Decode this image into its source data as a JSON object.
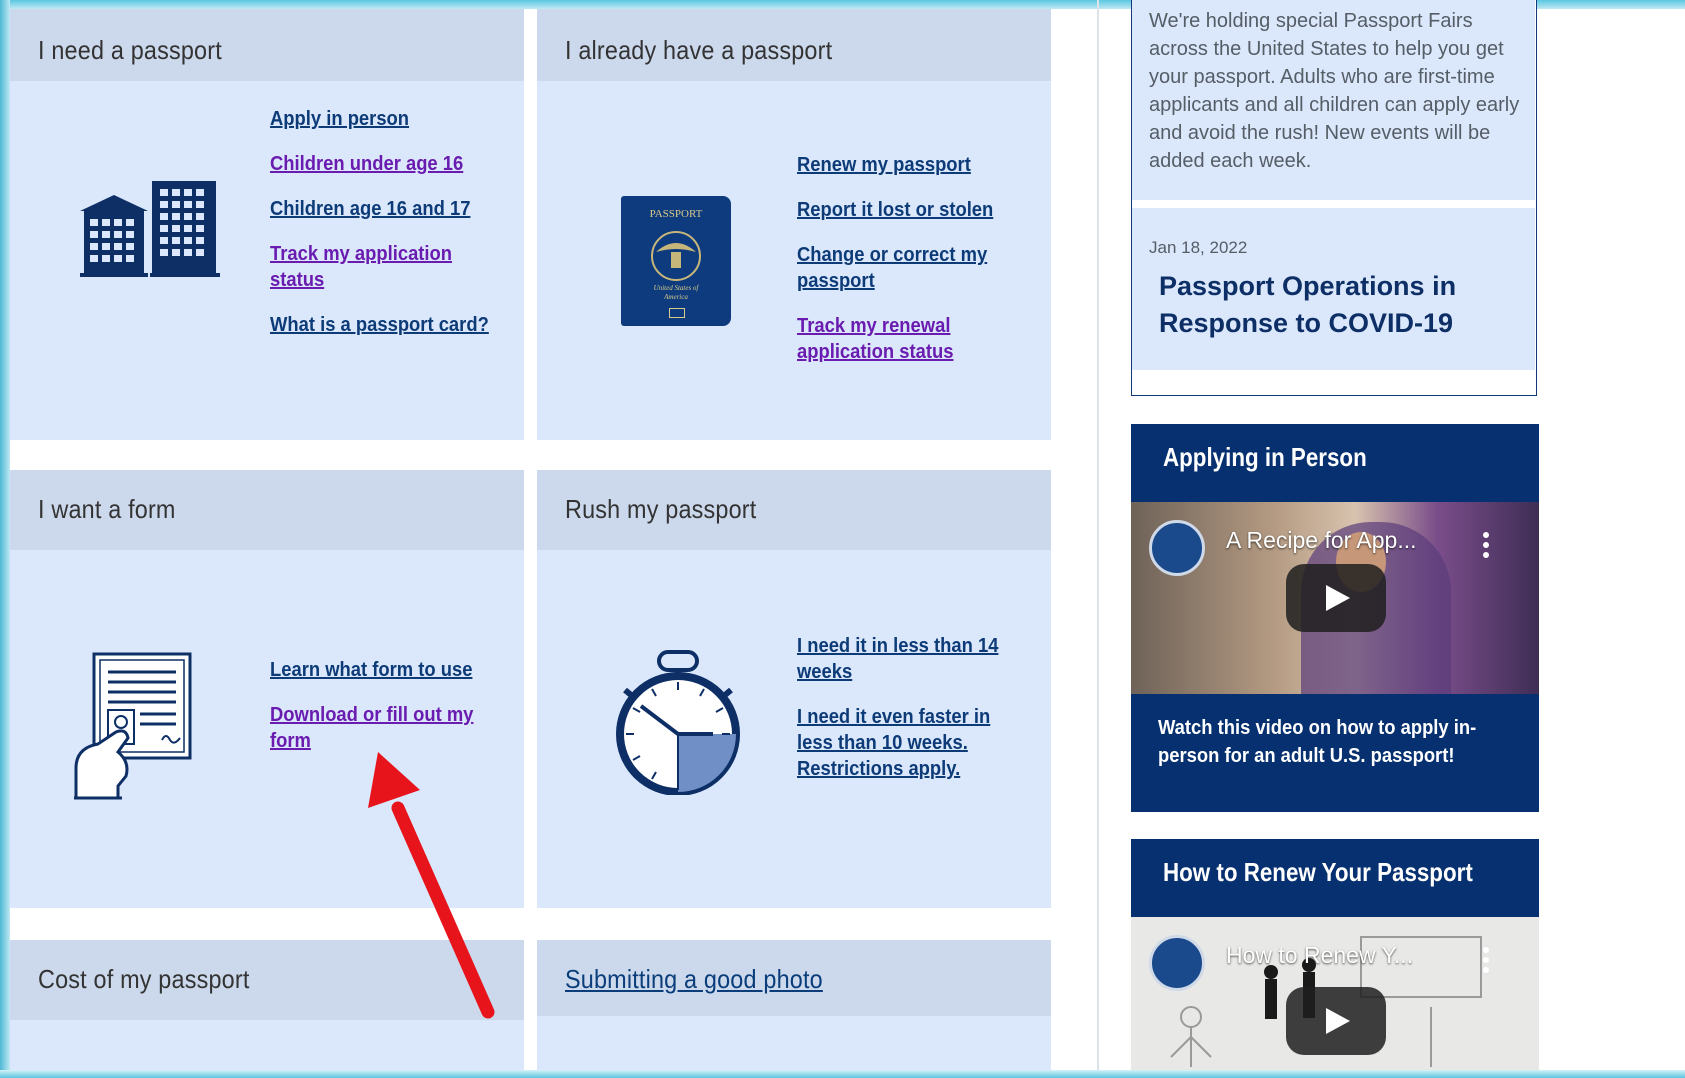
{
  "cards": {
    "need_passport": {
      "title": "I need a passport",
      "links": [
        "Apply in person",
        "Children under age 16",
        "Children age 16 and 17",
        "Track my application status",
        "What is a passport card?"
      ]
    },
    "have_passport": {
      "title": "I already have a passport",
      "links": [
        "Renew my passport",
        "Report it lost or stolen",
        "Change or correct my passport",
        "Track my renewal application status"
      ]
    },
    "want_form": {
      "title": "I want a form",
      "links": [
        "Learn what form to use",
        "Download or fill out my form"
      ]
    },
    "rush": {
      "title": "Rush my passport",
      "links": [
        "I need it in less than 14 weeks",
        "I need it even faster in less than 10 weeks. Restrictions apply."
      ]
    },
    "cost": {
      "title": "Cost of my passport"
    },
    "photo": {
      "title": "Submitting a good photo"
    }
  },
  "passport_icon": {
    "label": "PASSPORT",
    "sub": "United States of America"
  },
  "sidebar": {
    "fairs_text": "We're holding special Passport Fairs across the United States to help you get your passport. Adults who are first-time applicants and all children can apply early and avoid the rush! New events will be added each week.",
    "news_date": "Jan 18, 2022",
    "news_headline": "Passport Operations in Response to COVID-19",
    "video1": {
      "heading": "Applying in Person",
      "video_title": "A Recipe for App...",
      "caption": "Watch this video on how to apply in-person for an adult U.S. passport!"
    },
    "video2": {
      "heading": "How to Renew Your Passport",
      "video_title": "How to Renew Y..."
    }
  },
  "colors": {
    "card_bg": "#dbe8fb",
    "header_bg": "#ccd9ec",
    "link": "#0d3b78",
    "visited": "#6a1cb0",
    "navy": "#06306f",
    "arrow": "#e8141b"
  }
}
